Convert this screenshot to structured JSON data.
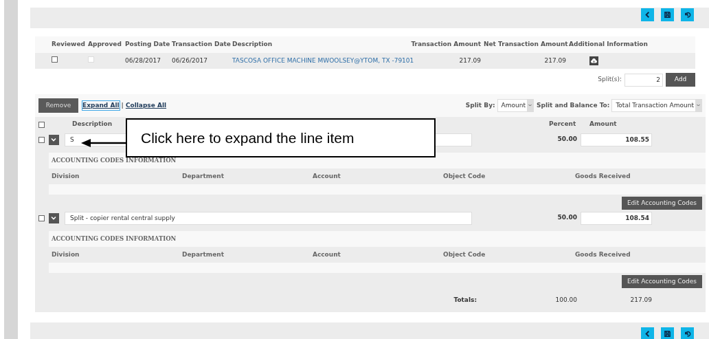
{
  "toolbar": {
    "buttons": [
      {
        "kind": "back"
      },
      {
        "kind": "save"
      },
      {
        "kind": "undo"
      }
    ]
  },
  "transactions": {
    "columns": [
      "Reviewed",
      "Approved",
      "Posting Date",
      "Transaction Date",
      "Description",
      "Transaction Amount",
      "Net Transaction Amount",
      "Additional Information"
    ],
    "rows": [
      {
        "reviewed": false,
        "approved": false,
        "approved_disabled": true,
        "posting_date": "06/28/2017",
        "transaction_date": "06/26/2017",
        "description": "TASCOSA OFFICE MACHINE MWOOLSEY@YTOM, TX -79101",
        "transaction_amount": "217.09",
        "net_amount": "217.09"
      }
    ]
  },
  "splits": {
    "label": "Split(s):",
    "value": "2",
    "add_button": "Add"
  },
  "split_panel": {
    "remove_button": "Remove",
    "links": [
      {
        "label": "Expand All",
        "selected": true
      },
      {
        "label": "Collapse All",
        "selected": false
      }
    ],
    "separator": "|",
    "split_by": {
      "label": "Split By:",
      "value": "Amount"
    },
    "balance_to": {
      "label": "Split and Balance To:",
      "value": "Total Transaction Amount"
    },
    "all_checked": false,
    "columns": [
      "Description",
      "Percent",
      "Amount"
    ],
    "lines": [
      {
        "checked": false,
        "description": "S",
        "percent": "50.00",
        "amount": "108.55",
        "codes_title": "ACCOUNTING CODES INFORMATION",
        "code_columns": [
          "Division",
          "Department",
          "Account",
          "Object Code",
          "Goods Received"
        ],
        "edit_button": "Edit Accounting Codes"
      },
      {
        "checked": false,
        "description": "Split - copier rental central supply",
        "percent": "50.00",
        "amount": "108.54",
        "codes_title": "ACCOUNTING CODES INFORMATION",
        "code_columns": [
          "Division",
          "Department",
          "Account",
          "Object Code",
          "Goods Received"
        ],
        "edit_button": "Edit Accounting Codes"
      }
    ],
    "totals": {
      "label": "Totals:",
      "percent": "100.00",
      "amount": "217.09"
    }
  },
  "callout": {
    "text": "Click here to expand the line item"
  },
  "bottom_toolbar": {
    "buttons": [
      {
        "kind": "back"
      },
      {
        "kind": "save"
      },
      {
        "kind": "undo"
      }
    ]
  }
}
